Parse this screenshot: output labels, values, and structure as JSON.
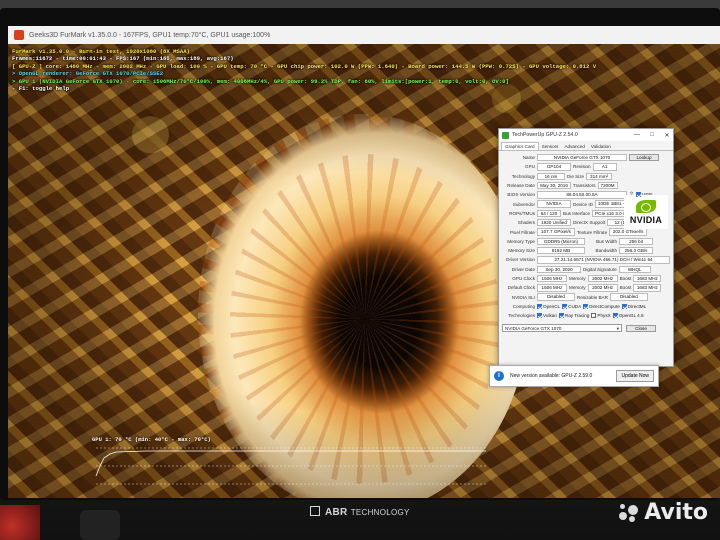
{
  "furmark": {
    "window_title": "Geeks3D FurMark v1.35.0.0 - 167FPS, GPU1 temp:70°C, GPU1 usage:100%",
    "overlay": [
      {
        "text": "FurMark v1.35.0.0 - Burn-in test, 1920x1080 (8X MSAA)",
        "color": "yellow"
      },
      {
        "text": "Frames:11672 - time:00:01:43 - FPS:167 (min:165, max:189, avg:167)",
        "color": "white"
      },
      {
        "text": "[ GPU-Z ] core: 1480 MHz - mem: 2002 MHz - GPU load: 100 % - GPU temp: 70 °C - GPU chip power: 102.0 W (PPW: 1.640) - Board power: 144.5 W (PPW: 0.725) - GPU voltage: 0.812 V",
        "color": "yellow"
      },
      {
        "text": "> OpenGL renderer: GeForce GTX 1070/PCIe/SSE2",
        "color": "cyan"
      },
      {
        "text": "> GPU 1 (NVIDIA GeForce GTX 1070) - core: 1506MHz/70°C/100%, mem: 4006MHz/4%, GPU power: 99.2% TDP, fan: 60%, limits:[power:1, temp:0, volt:0, OV:0]",
        "color": "green"
      },
      {
        "text": "- F1: toggle help",
        "color": "white"
      }
    ],
    "graph_label": "GPU 1: 70 °C (min: 40°C - max: 70°C)"
  },
  "gpuz": {
    "title": "TechPowerUp GPU-Z 2.54.0",
    "window_buttons": [
      "—",
      "□",
      "✕"
    ],
    "tabs": [
      "Graphics Card",
      "Sensors",
      "Advanced",
      "Validation"
    ],
    "lookup_button": "Lookup",
    "rows": {
      "name": {
        "label": "Name",
        "value": "NVIDIA GeForce GTX 1070"
      },
      "gpu": {
        "label": "GPU",
        "value": "GP104",
        "label2": "Revision",
        "value2": "A1"
      },
      "technology": {
        "label": "Technology",
        "value": "16 nm",
        "label2": "Die Size",
        "value2": "314 mm²"
      },
      "release_date": {
        "label": "Release Date",
        "value": "May 30, 2016",
        "label2": "Transistors",
        "value2": "7200M"
      },
      "bios_version": {
        "label": "BIOS Version",
        "value": "86.04.50.00.5A",
        "uefi": "UEFI"
      },
      "subvendor": {
        "label": "Subvendor",
        "value": "NVIDIA",
        "label2": "Device ID",
        "value2": "10DE 1B81 - 10DE 1B81"
      },
      "rops": {
        "label": "ROPs/TMUs",
        "value": "64 / 120",
        "label2": "Bus Interface",
        "value2": "PCIe x16 3.0 @ x16 3.0",
        "help": "?"
      },
      "shaders": {
        "label": "Shaders",
        "value": "1920 Unified",
        "label2": "DirectX Support",
        "value2": "12 (12_1)"
      },
      "pixel_fillrate": {
        "label": "Pixel Fillrate",
        "value": "107.7 GPixel/s",
        "label2": "Texture Fillrate",
        "value2": "202.0 GTexel/s"
      },
      "memory_type": {
        "label": "Memory Type",
        "value": "GDDR5 (Micron)",
        "label2": "Bus Width",
        "value2": "256 bit"
      },
      "memory_size": {
        "label": "Memory Size",
        "value": "8192 MB",
        "label2": "Bandwidth",
        "value2": "256.3 GB/s"
      },
      "driver_version": {
        "label": "Driver Version",
        "value": "27.21.14.5671 (NVIDIA 456.71) DCH / Win11 64"
      },
      "driver_date": {
        "label": "Driver Date",
        "value": "Sep 30, 2020",
        "label2": "Digital Signature",
        "value2": "WHQL"
      },
      "gpu_clock": {
        "label": "GPU Clock",
        "value": "1506 MHz",
        "label2": "Memory",
        "value2": "2002 MHz",
        "label3": "Boost",
        "value3": "1683 MHz"
      },
      "default_clock": {
        "label": "Default Clock",
        "value": "1506 MHz",
        "label2": "Memory",
        "value2": "2002 MHz",
        "label3": "Boost",
        "value3": "1683 MHz"
      },
      "nvidia_sli": {
        "label": "NVIDIA SLI",
        "value": "Disabled",
        "label2": "Resizable BAR",
        "value2": "Disabled"
      }
    },
    "computing": {
      "label": "Computing",
      "items": [
        {
          "name": "OpenCL",
          "checked": true
        },
        {
          "name": "CUDA",
          "checked": true
        },
        {
          "name": "DirectCompute",
          "checked": true
        },
        {
          "name": "DirectML",
          "checked": true
        }
      ]
    },
    "technologies": {
      "label": "Technologies",
      "items": [
        {
          "name": "Vulkan",
          "checked": true
        },
        {
          "name": "Ray Tracing",
          "checked": true
        },
        {
          "name": "PhysX",
          "checked": false
        },
        {
          "name": "OpenGL 4.6",
          "checked": true
        }
      ]
    },
    "selected_gpu": "NVIDIA GeForce GTX 1070",
    "close_button": "Close",
    "logo_text": "NVIDIA"
  },
  "update_popup": {
    "icon": "i",
    "text": "New version available: GPU-Z 2.59.0",
    "button": "Update Now"
  },
  "monitor": {
    "brand": "ABR",
    "brand_sub": "TECHNOLOGY"
  },
  "watermark": {
    "text": "Avito"
  }
}
